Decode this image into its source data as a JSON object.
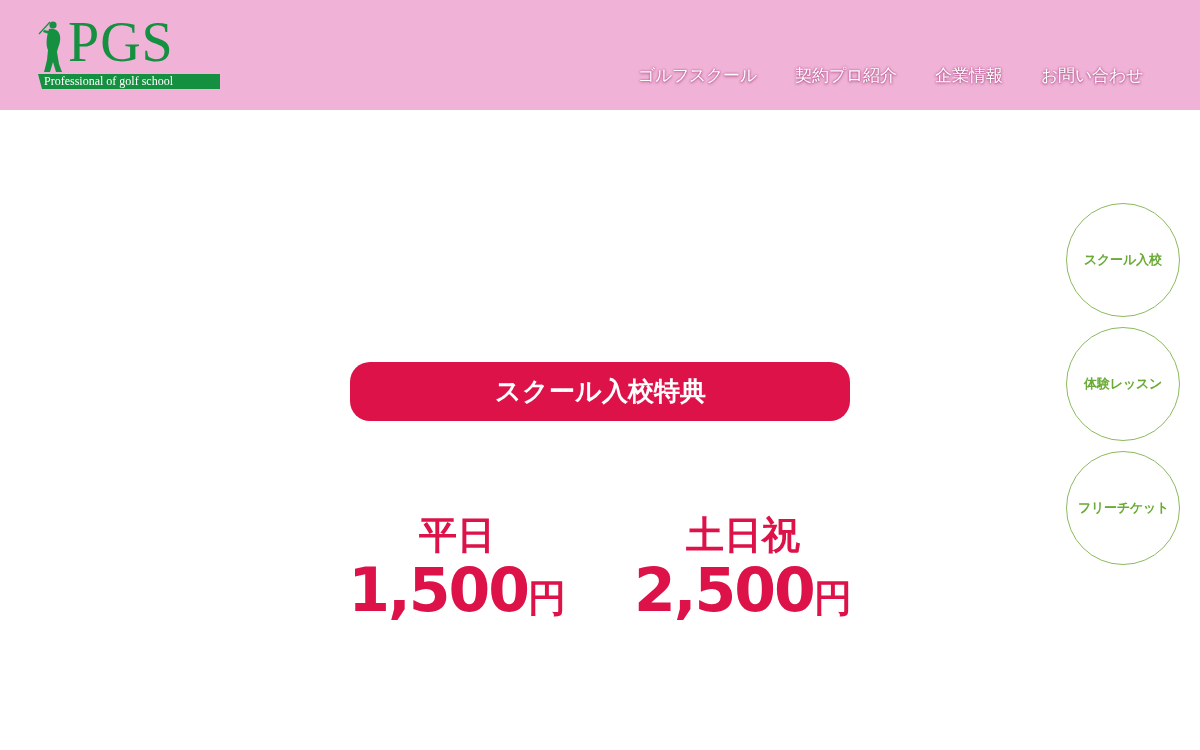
{
  "header": {
    "logo": {
      "title": "PGS",
      "tagline": "Professional of golf school"
    },
    "nav": [
      "ゴルフスクール",
      "契約プロ紹介",
      "企業情報",
      "お問い合わせ"
    ]
  },
  "side_menu": [
    "スクール入校",
    "体験レッスン",
    "フリーチケット"
  ],
  "benefit": {
    "heading": "スクール入校特典",
    "prices": [
      {
        "day": "平日",
        "amount": "1,500",
        "unit": "円"
      },
      {
        "day": "土日祝",
        "amount": "2,500",
        "unit": "円"
      }
    ]
  }
}
